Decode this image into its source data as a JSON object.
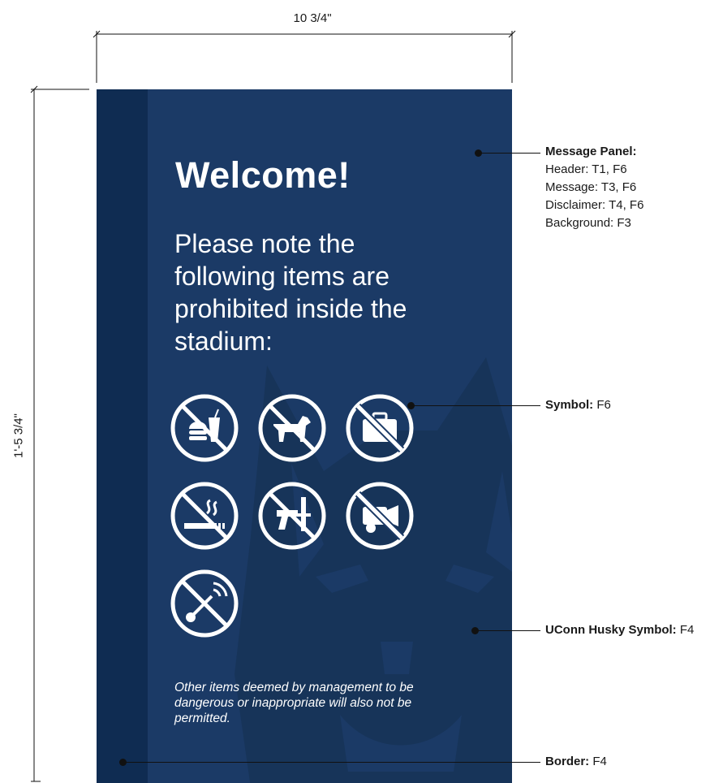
{
  "dimensions": {
    "width_label": "10 3/4\"",
    "height_label": "1'-5 3/4\""
  },
  "sign": {
    "header": "Welcome!",
    "message": "Please note the following items are prohibited inside the stadium:",
    "disclaimer": "Other items deemed by management to be dangerous or inappropriate will also not be permitted.",
    "colors": {
      "background": "#1b3a66",
      "border": "#0f2c52",
      "symbol": "#ffffff",
      "husky": "#173459"
    },
    "symbols": [
      {
        "name": "no-food-drink-icon"
      },
      {
        "name": "no-pets-icon"
      },
      {
        "name": "no-bags-icon"
      },
      {
        "name": "no-smoking-icon"
      },
      {
        "name": "no-weapons-icon"
      },
      {
        "name": "no-cameras-icon"
      },
      {
        "name": "no-selfie-sticks-icon"
      }
    ]
  },
  "callouts": {
    "message_panel": {
      "title": "Message Panel:",
      "lines": [
        "Header: T1, F6",
        "Message: T3, F6",
        "Disclaimer: T4, F6",
        "Background: F3"
      ]
    },
    "symbol": {
      "title": "Symbol:",
      "value": "F6"
    },
    "husky": {
      "title": "UConn Husky Symbol:",
      "value": "F4"
    },
    "border": {
      "title": "Border:",
      "value": "F4"
    }
  }
}
